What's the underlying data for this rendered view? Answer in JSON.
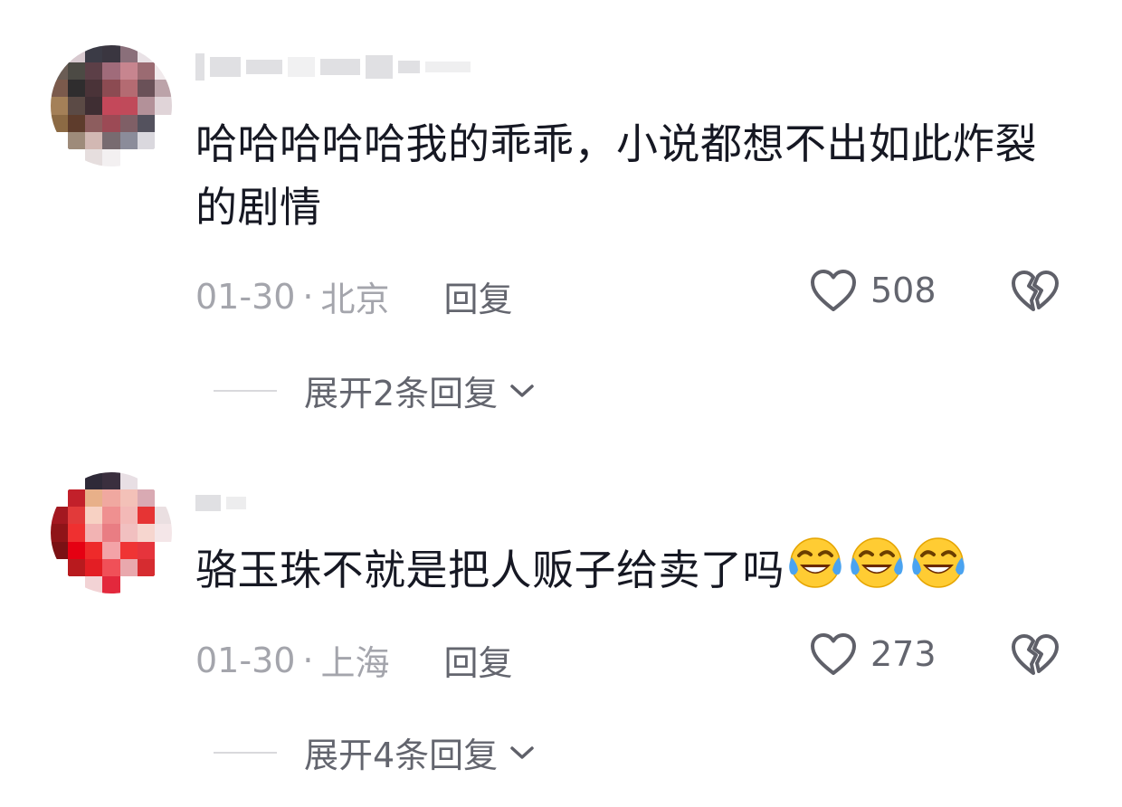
{
  "comments": [
    {
      "username": "",
      "text": "哈哈哈哈哈我的乖乖，小说都想不出如此炸裂的剧情",
      "date": "01-30",
      "separator": "·",
      "location": "北京",
      "reply_label": "回复",
      "like_count": "508",
      "expand_label": "展开2条回复",
      "emojis": []
    },
    {
      "username": "",
      "text": "骆玉珠不就是把人贩子给卖了吗",
      "date": "01-30",
      "separator": "·",
      "location": "上海",
      "reply_label": "回复",
      "like_count": "273",
      "expand_label": "展开4条回复",
      "emojis": [
        "laughing-crying-emoji",
        "laughing-crying-emoji",
        "laughing-crying-emoji"
      ]
    }
  ],
  "icons": {
    "like": "heart-outline-icon",
    "dislike": "broken-heart-icon",
    "expand": "chevron-down-icon"
  },
  "colors": {
    "text_primary": "#161823",
    "text_meta": "#a4a5ac",
    "text_secondary": "#63656e",
    "emoji_face": "#ffcc33",
    "emoji_tear": "#4aa3f0"
  }
}
